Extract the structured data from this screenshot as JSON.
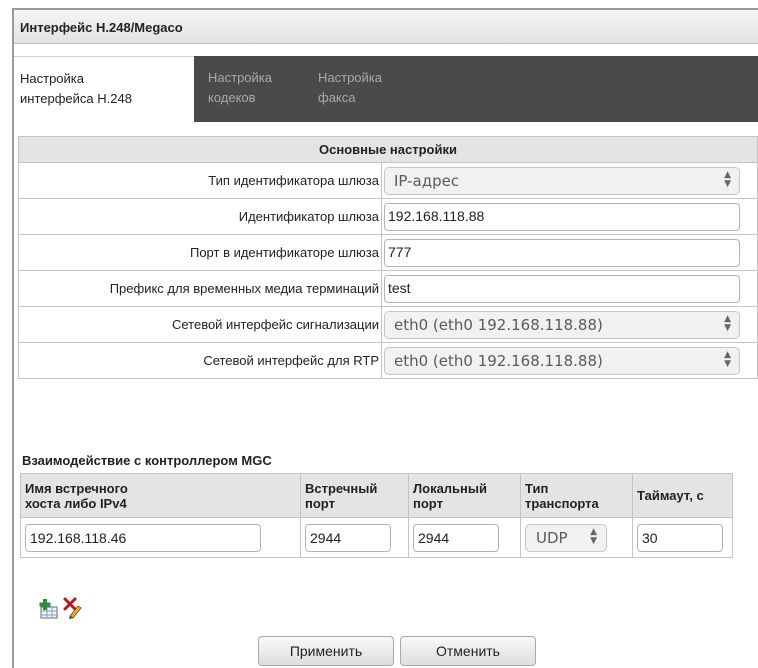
{
  "window": {
    "title": "Интерфейс H.248/Megaco"
  },
  "tabs": [
    {
      "line1": "Настройка",
      "line2": "интерфейса H.248"
    },
    {
      "line1": "Настройка",
      "line2": "кодеков"
    },
    {
      "line1": "Настройка",
      "line2": "факса"
    }
  ],
  "settings": {
    "header": "Основные настройки",
    "gateway_id_type": {
      "label": "Тип идентификатора шлюза",
      "value": "IP-адрес"
    },
    "gateway_id": {
      "label": "Идентификатор шлюза",
      "value": "192.168.118.88"
    },
    "gateway_id_port": {
      "label": "Порт в идентификаторе шлюза",
      "value": "777"
    },
    "media_prefix": {
      "label": "Префикс для временных медиа терминаций",
      "value": "test"
    },
    "signaling_iface": {
      "label": "Сетевой интерфейс сигнализации",
      "value": "eth0 (eth0 192.168.118.88)"
    },
    "rtp_iface": {
      "label": "Сетевой интерфейс для RTP",
      "value": "eth0 (eth0 192.168.118.88)"
    }
  },
  "mgc": {
    "title": "Взаимодействие с контроллером MGC",
    "columns": {
      "host_l1": "Имя встречного",
      "host_l2": "хоста либо IPv4",
      "remote_l1": "Встречный",
      "remote_l2": "порт",
      "local_l1": "Локальный",
      "local_l2": "порт",
      "transport_l1": "Тип",
      "transport_l2": "транспорта",
      "timeout": "Таймаут, с"
    },
    "row": {
      "host": "192.168.118.46",
      "remote_port": "2944",
      "local_port": "2944",
      "transport": "UDP",
      "timeout": "30"
    }
  },
  "icons": {
    "add": "add-row-icon",
    "delete": "delete-edit-icon"
  },
  "buttons": {
    "apply": "Применить",
    "cancel": "Отменить"
  },
  "colors": {
    "tabbar": "#4a4a4a",
    "table_header": "#e4e4e4",
    "delete_icon": "#c0141e",
    "add_icon": "#2f8f3a"
  }
}
